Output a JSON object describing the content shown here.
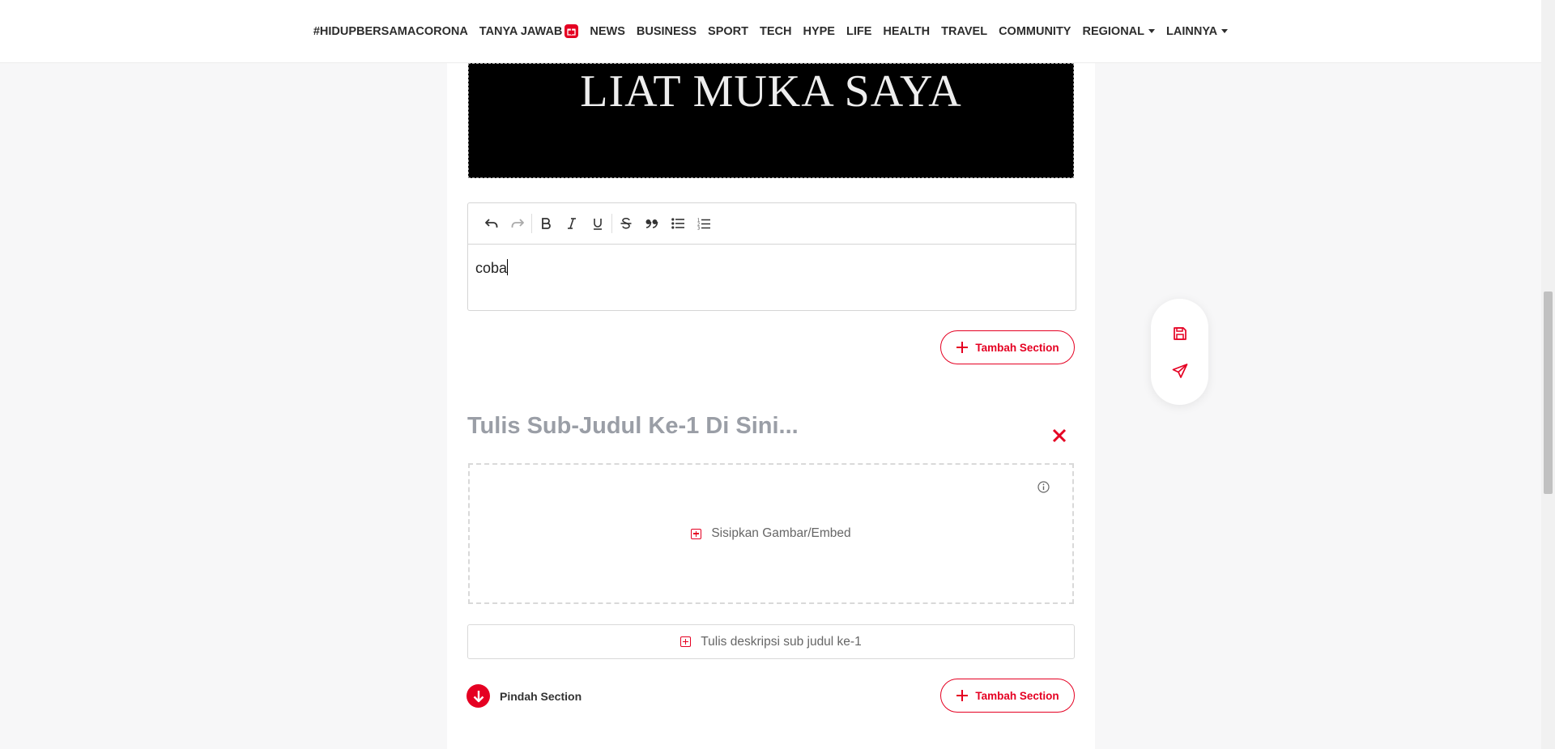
{
  "nav": {
    "items": [
      {
        "label": "#HIDUPBERSAMACORONA"
      },
      {
        "label": "TANYA JAWAB",
        "badge": true
      },
      {
        "label": "NEWS"
      },
      {
        "label": "BUSINESS"
      },
      {
        "label": "SPORT"
      },
      {
        "label": "TECH"
      },
      {
        "label": "HYPE"
      },
      {
        "label": "LIFE"
      },
      {
        "label": "HEALTH"
      },
      {
        "label": "TRAVEL"
      },
      {
        "label": "COMMUNITY"
      },
      {
        "label": "REGIONAL",
        "dropdown": true
      },
      {
        "label": "LAINNYA",
        "dropdown": true
      }
    ]
  },
  "hero_image": {
    "caption": "LIAT MUKA SAYA"
  },
  "editor": {
    "toolbar": [
      "undo-icon",
      "redo-icon",
      "bold-icon",
      "italic-icon",
      "underline-icon",
      "strikethrough-icon",
      "quote-icon",
      "bullet-list-icon",
      "numbered-list-icon"
    ],
    "content": "coba"
  },
  "section": {
    "add_section_label": "Tambah Section",
    "subtitle_placeholder": "Tulis Sub-Judul Ke-1 Di Sini...",
    "insert_media_label": "Sisipkan Gambar/Embed",
    "description_label": "Tulis deskripsi sub judul ke-1",
    "move_section_label": "Pindah Section"
  },
  "colors": {
    "accent": "#e50022",
    "placeholder": "#9a9ea6"
  }
}
